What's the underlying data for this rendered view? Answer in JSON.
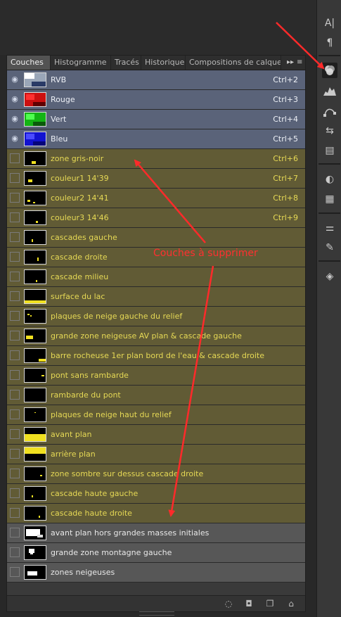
{
  "tabs": {
    "items": [
      "Couches",
      "Histogramme",
      "Tracés",
      "Historique",
      "Compositions de calque"
    ],
    "active": "Couches"
  },
  "channels": [
    {
      "name": "RVB",
      "shortcut": "Ctrl+2",
      "kind": "composite",
      "visible": true
    },
    {
      "name": "Rouge",
      "shortcut": "Ctrl+3",
      "kind": "composite",
      "visible": true
    },
    {
      "name": "Vert",
      "shortcut": "Ctrl+4",
      "kind": "composite",
      "visible": true
    },
    {
      "name": "Bleu",
      "shortcut": "Ctrl+5",
      "kind": "composite",
      "visible": true
    },
    {
      "name": "zone gris-noir",
      "shortcut": "Ctrl+6",
      "kind": "highlighted",
      "visible": false
    },
    {
      "name": "couleur1 14'39",
      "shortcut": "Ctrl+7",
      "kind": "highlighted",
      "visible": false
    },
    {
      "name": "couleur2 14'41",
      "shortcut": "Ctrl+8",
      "kind": "highlighted",
      "visible": false
    },
    {
      "name": "couleur3 14'46",
      "shortcut": "Ctrl+9",
      "kind": "highlighted",
      "visible": false
    },
    {
      "name": "cascades gauche",
      "shortcut": "",
      "kind": "highlighted",
      "visible": false
    },
    {
      "name": "cascade droite",
      "shortcut": "",
      "kind": "highlighted",
      "visible": false
    },
    {
      "name": "cascade milieu",
      "shortcut": "",
      "kind": "highlighted",
      "visible": false
    },
    {
      "name": "surface du lac",
      "shortcut": "",
      "kind": "highlighted",
      "visible": false
    },
    {
      "name": "plaques de neige gauche du relief",
      "shortcut": "",
      "kind": "highlighted",
      "visible": false
    },
    {
      "name": "grande zone neigeuse AV plan & cascade gauche",
      "shortcut": "",
      "kind": "highlighted",
      "visible": false
    },
    {
      "name": "barre rocheuse 1er plan bord de l'eau & cascade droite",
      "shortcut": "",
      "kind": "highlighted",
      "visible": false
    },
    {
      "name": "pont sans rambarde",
      "shortcut": "",
      "kind": "highlighted",
      "visible": false
    },
    {
      "name": "rambarde du pont",
      "shortcut": "",
      "kind": "highlighted",
      "visible": false
    },
    {
      "name": "plaques de neige haut du relief",
      "shortcut": "",
      "kind": "highlighted",
      "visible": false
    },
    {
      "name": "avant plan",
      "shortcut": "",
      "kind": "highlighted",
      "visible": false
    },
    {
      "name": "arrière plan",
      "shortcut": "",
      "kind": "highlighted",
      "visible": false
    },
    {
      "name": "zone sombre sur dessus cascade droite",
      "shortcut": "",
      "kind": "highlighted",
      "visible": false
    },
    {
      "name": "cascade haute gauche",
      "shortcut": "",
      "kind": "highlighted",
      "visible": false
    },
    {
      "name": "cascade haute droite",
      "shortcut": "",
      "kind": "highlighted",
      "visible": false
    },
    {
      "name": "avant plan hors grandes masses initiales",
      "shortcut": "",
      "kind": "normal",
      "visible": false
    },
    {
      "name": "grande zone montagne gauche",
      "shortcut": "",
      "kind": "normal",
      "visible": false
    },
    {
      "name": "zones neigeuses",
      "shortcut": "",
      "kind": "normal",
      "visible": false
    }
  ],
  "annotation": {
    "text": "Couches à supprimer",
    "color": "#ff3030"
  },
  "footer": {
    "buttons": [
      "load-selection-icon",
      "save-selection-icon",
      "new-channel-icon",
      "trash-icon"
    ]
  },
  "toolbar": {
    "icons": [
      "character-icon",
      "paragraph-icon",
      "channels-icon",
      "histogram-icon",
      "paths-icon",
      "history-icon",
      "layer-comps-icon",
      "adjustments-icon",
      "styles-icon",
      "brush-presets-icon",
      "brush-icon",
      "layers-icon"
    ]
  },
  "colors": {
    "composite_row": "#5a6379",
    "highlighted_row": "#615b35",
    "highlighted_text": "#e6d955",
    "normal_row": "#575757",
    "arrow": "#ff2a2a"
  }
}
